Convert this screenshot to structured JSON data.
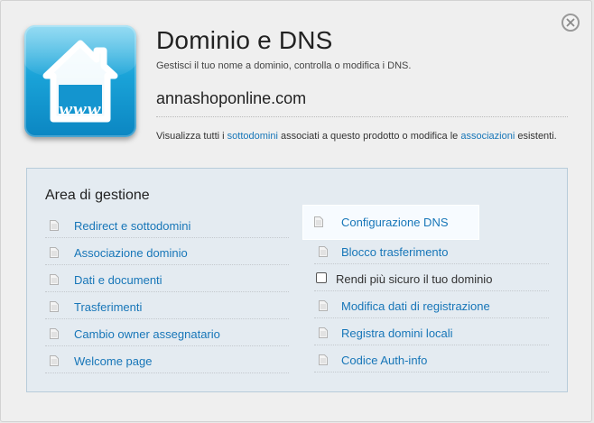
{
  "header": {
    "title": "Dominio e DNS",
    "subtitle": "Gestisci il tuo nome a dominio, controlla o modifica i DNS.",
    "domain": "annashoponline.com",
    "info": {
      "prefix": "Visualizza tutti i ",
      "link1": "sottodomini",
      "middle": " associati a questo prodotto o modifica le ",
      "link2": "associazioni",
      "suffix": " esistenti."
    },
    "icon_caption": "www"
  },
  "panel": {
    "title": "Area di gestione",
    "left_items": [
      "Redirect e sottodomini",
      "Associazione dominio",
      "Dati e documenti",
      "Trasferimenti",
      "Cambio owner assegnatario",
      "Welcome page"
    ],
    "right_items": [
      "Configurazione DNS",
      "Blocco trasferimento",
      "Modifica dati di registrazione",
      "Registra domini locali",
      "Codice Auth-info"
    ],
    "checkbox": {
      "label": "Rendi più sicuro il tuo dominio",
      "checked": false
    }
  },
  "colors": {
    "link": "#1776b8",
    "panel_bg": "#e4ebf1",
    "icon_blue": "#1aa3d8"
  },
  "icons": {
    "close": "close-icon",
    "app": "house-www-icon",
    "item": "document-icon"
  }
}
